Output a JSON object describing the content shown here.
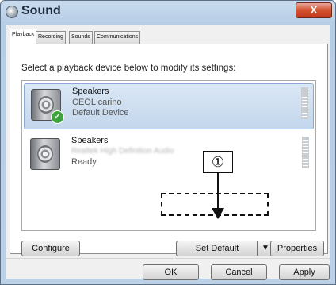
{
  "window": {
    "title": "Sound",
    "close_glyph": "X"
  },
  "tabs": [
    {
      "label": "Playback",
      "active": true
    },
    {
      "label": "Recording",
      "active": false
    },
    {
      "label": "Sounds",
      "active": false
    },
    {
      "label": "Communications",
      "active": false
    }
  ],
  "instruction": "Select a playback device below to modify its settings:",
  "devices": [
    {
      "name": "Speakers",
      "description": "CEOL carino",
      "status": "Default Device",
      "selected": true,
      "default_check": true,
      "icon": "speaker-icon"
    },
    {
      "name": "Speakers",
      "description": "Realtek High Definition Audio",
      "status": "Ready",
      "selected": false,
      "default_check": false,
      "icon": "speaker-icon"
    }
  ],
  "buttons": {
    "configure": {
      "mnemonic": "C",
      "rest": "onfigure"
    },
    "set_default": {
      "mnemonic": "S",
      "rest": "et Default",
      "arrow": "▼"
    },
    "properties": {
      "mnemonic": "P",
      "rest": "roperties"
    },
    "ok": "OK",
    "cancel": "Cancel",
    "apply": "Apply"
  },
  "annotation": {
    "number": "①"
  },
  "colors": {
    "accent": "#3ca43a",
    "selection": "#c3d6ec",
    "close_button": "#d3512f"
  }
}
